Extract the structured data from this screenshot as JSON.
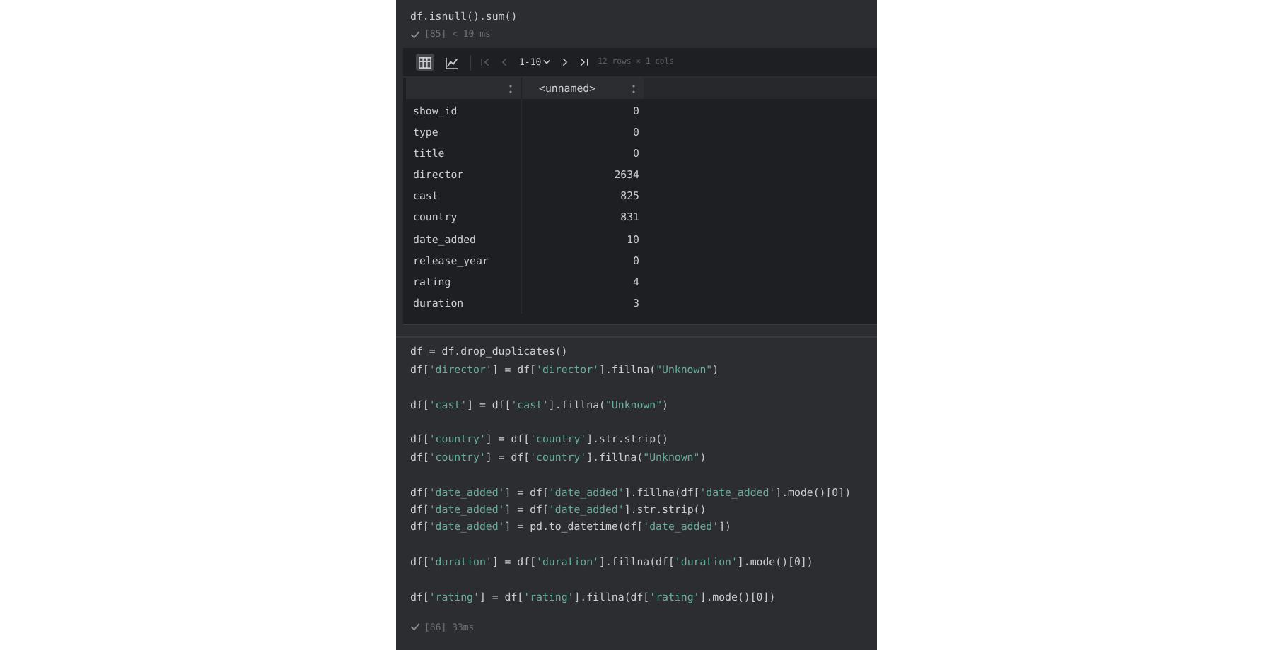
{
  "cell_1": {
    "code": "df.isnull().sum()",
    "status": {
      "ok": true,
      "text": "[85] < 10 ms"
    }
  },
  "output": {
    "toolbar": {
      "views": [
        {
          "kind": "table",
          "selected": true
        },
        {
          "kind": "chart",
          "selected": false
        }
      ],
      "page_range": "1-10",
      "rows_info": "12 rows × 1 cols"
    },
    "table": {
      "columns": [
        "<unnamed>"
      ],
      "rows": [
        {
          "label": "show_id",
          "value": "0"
        },
        {
          "label": "type",
          "value": "0"
        },
        {
          "label": "title",
          "value": "0"
        },
        {
          "label": "director",
          "value": "2634"
        },
        {
          "label": "cast",
          "value": "825"
        },
        {
          "label": "country",
          "value": "831"
        },
        {
          "label": "date_added",
          "value": "10"
        },
        {
          "label": "release_year",
          "value": "0"
        },
        {
          "label": "rating",
          "value": "4"
        },
        {
          "label": "duration",
          "value": "3"
        }
      ]
    }
  },
  "cell_2": {
    "code_blocks": [
      [
        [
          {
            "text": "df = df.drop_duplicates()",
            "kind": "plain"
          }
        ],
        [
          {
            "text": "df[",
            "kind": "plain"
          },
          {
            "text": "'director'",
            "kind": "string"
          },
          {
            "text": "] = df[",
            "kind": "plain"
          },
          {
            "text": "'director'",
            "kind": "string"
          },
          {
            "text": "].fillna(",
            "kind": "plain"
          },
          {
            "text": "\"Unknown\"",
            "kind": "string"
          },
          {
            "text": ")",
            "kind": "plain"
          }
        ]
      ],
      [
        [
          {
            "text": "df[",
            "kind": "plain"
          },
          {
            "text": "'cast'",
            "kind": "string"
          },
          {
            "text": "] = df[",
            "kind": "plain"
          },
          {
            "text": "'cast'",
            "kind": "string"
          },
          {
            "text": "].fillna(",
            "kind": "plain"
          },
          {
            "text": "\"Unknown\"",
            "kind": "string"
          },
          {
            "text": ")",
            "kind": "plain"
          }
        ]
      ],
      [
        [
          {
            "text": "df[",
            "kind": "plain"
          },
          {
            "text": "'country'",
            "kind": "string"
          },
          {
            "text": "] = df[",
            "kind": "plain"
          },
          {
            "text": "'country'",
            "kind": "string"
          },
          {
            "text": "].str.strip()",
            "kind": "plain"
          }
        ],
        [
          {
            "text": "df[",
            "kind": "plain"
          },
          {
            "text": "'country'",
            "kind": "string"
          },
          {
            "text": "] = df[",
            "kind": "plain"
          },
          {
            "text": "'country'",
            "kind": "string"
          },
          {
            "text": "].fillna(",
            "kind": "plain"
          },
          {
            "text": "\"Unknown\"",
            "kind": "string"
          },
          {
            "text": ")",
            "kind": "plain"
          }
        ]
      ],
      [
        [
          {
            "text": "df[",
            "kind": "plain"
          },
          {
            "text": "'date_added'",
            "kind": "string"
          },
          {
            "text": "] = df[",
            "kind": "plain"
          },
          {
            "text": "'date_added'",
            "kind": "string"
          },
          {
            "text": "].fillna(df[",
            "kind": "plain"
          },
          {
            "text": "'date_added'",
            "kind": "string"
          },
          {
            "text": "].mode()[0])",
            "kind": "plain"
          }
        ],
        [
          {
            "text": "df[",
            "kind": "plain"
          },
          {
            "text": "'date_added'",
            "kind": "string"
          },
          {
            "text": "] = df[",
            "kind": "plain"
          },
          {
            "text": "'date_added'",
            "kind": "string"
          },
          {
            "text": "].str.strip()",
            "kind": "plain"
          }
        ],
        [
          {
            "text": "df[",
            "kind": "plain"
          },
          {
            "text": "'date_added'",
            "kind": "string"
          },
          {
            "text": "] = pd.to_datetime(df[",
            "kind": "plain"
          },
          {
            "text": "'date_added'",
            "kind": "string"
          },
          {
            "text": "])",
            "kind": "plain"
          }
        ]
      ],
      [
        [
          {
            "text": "df[",
            "kind": "plain"
          },
          {
            "text": "'duration'",
            "kind": "string"
          },
          {
            "text": "] = df[",
            "kind": "plain"
          },
          {
            "text": "'duration'",
            "kind": "string"
          },
          {
            "text": "].fillna(df[",
            "kind": "plain"
          },
          {
            "text": "'duration'",
            "kind": "string"
          },
          {
            "text": "].mode()[0])",
            "kind": "plain"
          }
        ]
      ],
      [
        [
          {
            "text": "df[",
            "kind": "plain"
          },
          {
            "text": "'rating'",
            "kind": "string"
          },
          {
            "text": "] = df[",
            "kind": "plain"
          },
          {
            "text": "'rating'",
            "kind": "string"
          },
          {
            "text": "].fillna(df[",
            "kind": "plain"
          },
          {
            "text": "'rating'",
            "kind": "string"
          },
          {
            "text": "].mode()[0])",
            "kind": "plain"
          }
        ]
      ]
    ],
    "status": {
      "ok": true,
      "text": "[86] 33ms"
    }
  }
}
